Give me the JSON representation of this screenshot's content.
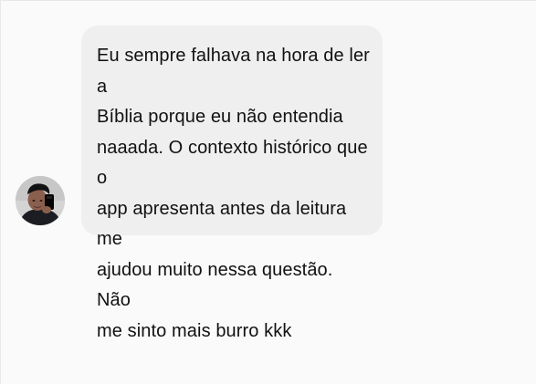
{
  "chat": {
    "message": {
      "text": "Eu sempre falhava na hora de ler a\nBíblia porque eu não entendia\nnaaada. O contexto histórico que o\napp apresenta antes da leitura me\najudou muito nessa questão. Não\nme sinto mais burro kkk"
    }
  },
  "colors": {
    "background": "#fafafa",
    "bubble": "#efefef",
    "text": "#111111",
    "divider": "#e7e7e7"
  },
  "icons": {
    "avatar": "user-photo"
  }
}
